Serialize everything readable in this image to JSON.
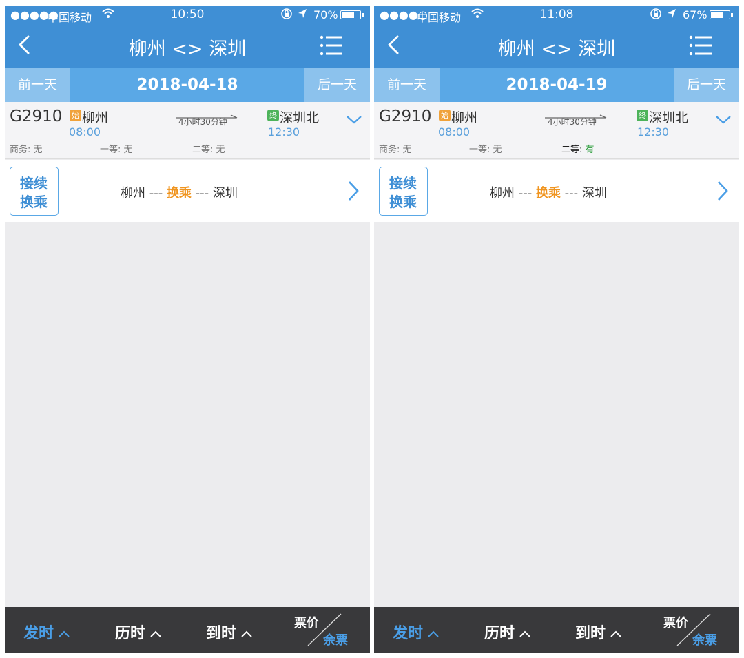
{
  "screens": [
    {
      "status": {
        "signal": "●●●●●",
        "carrier": "中国移动",
        "time": "10:50",
        "battery": "70%",
        "battery_level": 0.7
      },
      "title": "柳州 <> 深圳",
      "date_nav": {
        "prev": "前一天",
        "current": "2018-04-18",
        "next": "后一天"
      },
      "train": {
        "number": "G2910",
        "start_badge": "始",
        "from": "柳州",
        "depart": "08:00",
        "duration": "4小时30分钟",
        "end_badge": "终",
        "to": "深圳北",
        "arrive": "12:30",
        "seat_business": "商务: 无",
        "seat_first": "一等: 无",
        "seat_second_label": "二等: ",
        "seat_second_value": "无"
      },
      "transfer": {
        "line1": "接续",
        "line2": "换乘",
        "from": "柳州 --- ",
        "highlight": "换乘",
        "to": " --- 深圳"
      },
      "sortbar": {
        "depart": "发时",
        "duration": "历时",
        "arrive": "到时",
        "price": "票价",
        "remain": "余票"
      }
    },
    {
      "status": {
        "signal": "●●●●○",
        "carrier": "中国移动",
        "time": "11:08",
        "battery": "67%",
        "battery_level": 0.67
      },
      "title": "柳州 <> 深圳",
      "date_nav": {
        "prev": "前一天",
        "current": "2018-04-19",
        "next": "后一天"
      },
      "train": {
        "number": "G2910",
        "start_badge": "始",
        "from": "柳州",
        "depart": "08:00",
        "duration": "4小时30分钟",
        "end_badge": "终",
        "to": "深圳北",
        "arrive": "12:30",
        "seat_business": "商务: 无",
        "seat_first": "一等: 无",
        "seat_second_label": "二等: ",
        "seat_second_value": "有"
      },
      "transfer": {
        "line1": "接续",
        "line2": "换乘",
        "from": "柳州 --- ",
        "highlight": "换乘",
        "to": " --- 深圳"
      },
      "sortbar": {
        "depart": "发时",
        "duration": "历时",
        "arrive": "到时",
        "price": "票价",
        "remain": "余票"
      }
    }
  ]
}
